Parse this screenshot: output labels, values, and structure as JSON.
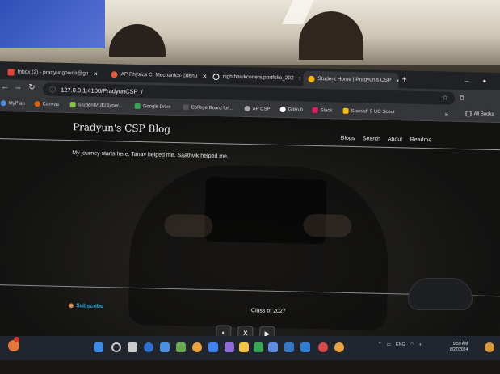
{
  "browser": {
    "tabs": [
      {
        "label": "Inbox (2) - pradyungowda@gn",
        "icon": "gmail-icon",
        "color": "#ea4335"
      },
      {
        "label": "AP Physics C: Mechanics-Edenu",
        "icon": "course-icon",
        "color": "#e05a3a"
      },
      {
        "label": "nighthawkcoders/portfolio_202",
        "icon": "github-icon",
        "color": "#ffffff"
      },
      {
        "label": "Student Home | Pradyun's CSP",
        "icon": "site-icon",
        "color": "#f4b400",
        "active": true
      }
    ],
    "new_tab": "+",
    "minimize": "–",
    "close": "●",
    "url": "127.0.0.1:4100/PradyunCSP_/",
    "bookmarks": [
      {
        "label": "MyPlan",
        "color": "#4a90e2"
      },
      {
        "label": "Canvas",
        "color": "#e66000"
      },
      {
        "label": "StudentVUE/Syner...",
        "color": "#8bc34a"
      },
      {
        "label": "Google Drive",
        "color": "#34a853"
      },
      {
        "label": "College Board for...",
        "color": "#555555"
      },
      {
        "label": "AP CSP",
        "color": "#aaaaaa"
      },
      {
        "label": "GitHub",
        "color": "#ffffff"
      },
      {
        "label": "Slack",
        "color": "#e01e5a"
      },
      {
        "label": "Spanish 5 UC Scout",
        "color": "#fbbc05"
      }
    ],
    "more": "»",
    "all_bookmarks": "All Books"
  },
  "site": {
    "title": "Pradyun's CSP Blog",
    "nav": [
      "Blogs",
      "Search",
      "About",
      "Readme"
    ],
    "intro": "My journey starts here. Tanav helped me. Saathvik helped me.",
    "subscribe": "Subscribe",
    "class_of": "Class of 2027",
    "social": [
      "github-icon",
      "x-icon",
      "youtube-icon"
    ]
  },
  "taskbar": {
    "tray_lang": "ENG",
    "time": "9:59 AM",
    "date": "8/27/2024"
  }
}
